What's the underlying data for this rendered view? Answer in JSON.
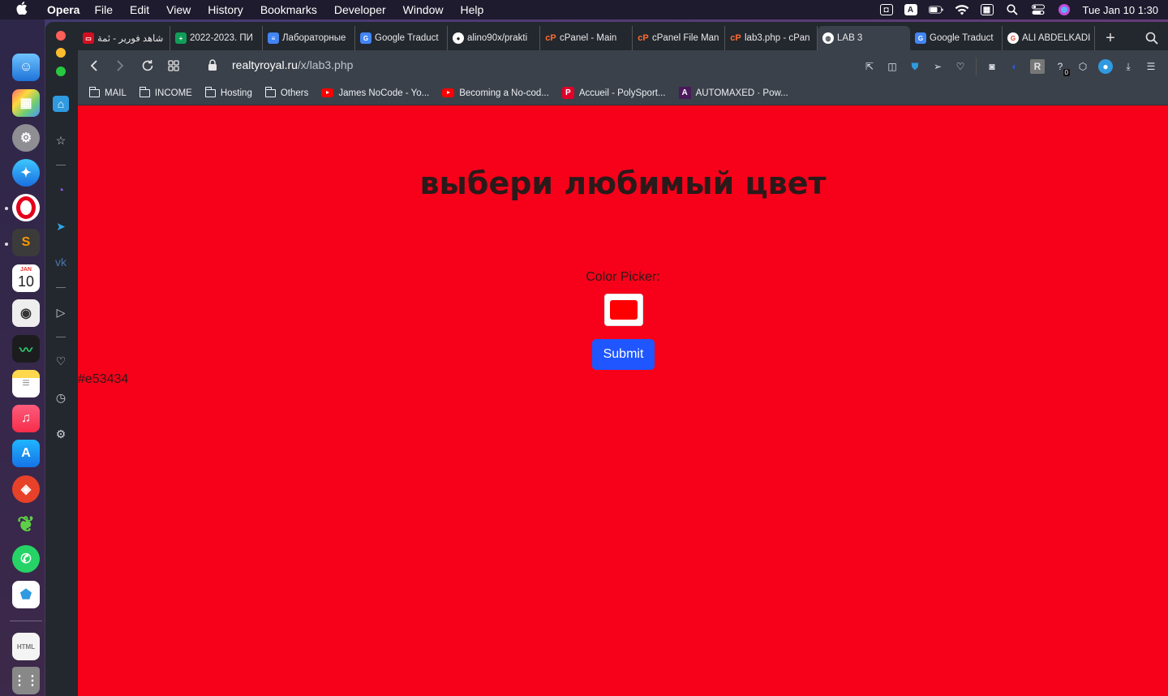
{
  "menubar": {
    "app_name": "Opera",
    "menus": [
      "File",
      "Edit",
      "View",
      "History",
      "Bookmarks",
      "Developer",
      "Window",
      "Help"
    ],
    "clock": "Tue Jan 10  1:30"
  },
  "dock": {
    "calendar_month": "JAN",
    "calendar_day": "10"
  },
  "tabs": [
    {
      "label": "شاهد فورير - ئمة",
      "color": "#d01020",
      "icon": "page-icon"
    },
    {
      "label": "2022-2023. ПИ",
      "color": "#0f9d58",
      "icon": "sheets-icon"
    },
    {
      "label": "Лабораторные",
      "color": "#4285f4",
      "icon": "docs-icon"
    },
    {
      "label": "Google Traduct",
      "color": "#4285f4",
      "icon": "translate-icon"
    },
    {
      "label": "alino90x/prakti",
      "color": "#ffffff",
      "icon": "github-icon"
    },
    {
      "label": "cPanel - Main",
      "color": "#ff6c2c",
      "icon": "cpanel-icon"
    },
    {
      "label": "cPanel File Man",
      "color": "#ff6c2c",
      "icon": "cpanel-icon"
    },
    {
      "label": "lab3.php - cPan",
      "color": "#ff6c2c",
      "icon": "cpanel-icon"
    },
    {
      "label": "LAB 3",
      "color": "#9aa0a6",
      "icon": "globe-icon"
    },
    {
      "label": "Google Traduct",
      "color": "#4285f4",
      "icon": "translate-icon"
    },
    {
      "label": "ALI ABDELKADI",
      "color": "#ea4335",
      "icon": "google-icon"
    }
  ],
  "active_tab_index": 8,
  "address": {
    "host": "realtyroyal.ru",
    "path": "/x/lab3.php"
  },
  "bookmarks": [
    {
      "label": "MAIL",
      "type": "folder"
    },
    {
      "label": "INCOME",
      "type": "folder"
    },
    {
      "label": "Hosting",
      "type": "folder"
    },
    {
      "label": "Others",
      "type": "folder"
    },
    {
      "label": "James NoCode - Yo...",
      "type": "youtube"
    },
    {
      "label": "Becoming a No-cod...",
      "type": "youtube"
    },
    {
      "label": "Accueil - PolySport...",
      "type": "p"
    },
    {
      "label": "AUTOMAXED · Pow...",
      "type": "a"
    }
  ],
  "page": {
    "title": "выбери любимый цвет",
    "picker_label": "Color Picker:",
    "selected_color": "#ff0000",
    "submit_label": "Submit",
    "output": "#e53434",
    "background": "#f7001a"
  },
  "toolbar": {
    "badge_count": "0"
  }
}
